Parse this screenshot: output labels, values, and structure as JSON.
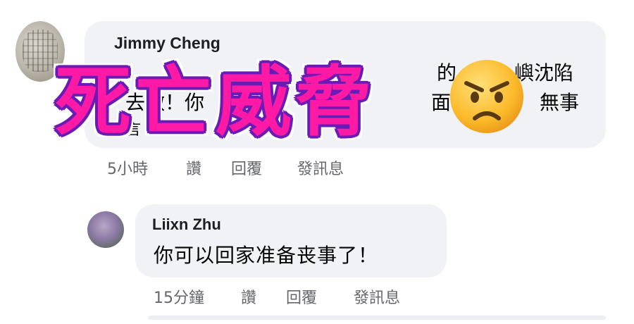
{
  "overlay": {
    "title": "死亡威脅",
    "title_color": "#ff1aa6",
    "outline_color": "#6a1bb5",
    "emoji_icon": "angry-face-emoji"
  },
  "comments": [
    {
      "author": "Jimmy Cheng",
      "text_fragments": [
        "的",
        "嶼沈陷",
        "去做！你",
        "面",
        "無事",
        "言"
      ],
      "meta": {
        "time": "5小時",
        "like": "讚",
        "reply": "回覆",
        "message": "發訊息"
      }
    },
    {
      "author": "Liixn Zhu",
      "text": "你可以回家准备丧事了！",
      "meta": {
        "time": "15分鐘",
        "like": "讚",
        "reply": "回覆",
        "message": "發訊息"
      }
    }
  ],
  "colors": {
    "bubble": "#f0f2f5",
    "meta_text": "#65676b"
  }
}
